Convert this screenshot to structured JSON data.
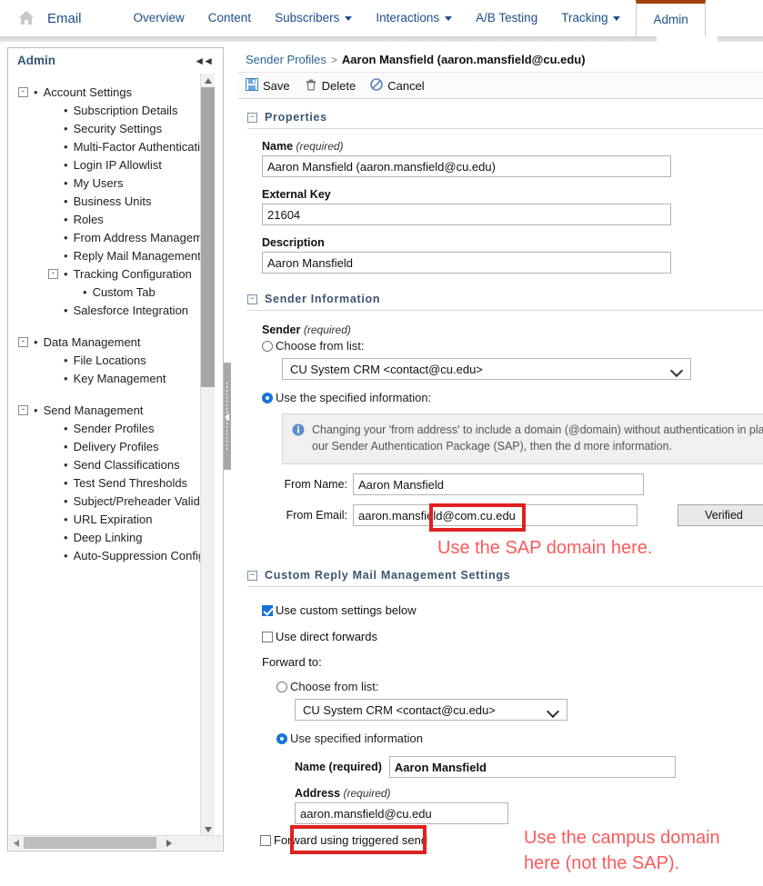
{
  "topnav": {
    "app_name": "Email",
    "home_icon": "home-icon",
    "items": [
      {
        "label": "Overview",
        "has_caret": false,
        "active": false
      },
      {
        "label": "Content",
        "has_caret": false,
        "active": false
      },
      {
        "label": "Subscribers",
        "has_caret": true,
        "active": false
      },
      {
        "label": "Interactions",
        "has_caret": true,
        "active": false
      },
      {
        "label": "A/B Testing",
        "has_caret": false,
        "active": false
      },
      {
        "label": "Tracking",
        "has_caret": true,
        "active": false
      },
      {
        "label": "Admin",
        "has_caret": false,
        "active": true
      }
    ],
    "active_tab_accent": "#a4400b"
  },
  "sidebar": {
    "title": "Admin",
    "collapse_icon": "collapse-left-icon",
    "tree": [
      {
        "label": "Account Settings",
        "level": 1,
        "expander": "-"
      },
      {
        "label": "Subscription Details",
        "level": 2
      },
      {
        "label": "Security Settings",
        "level": 2
      },
      {
        "label": "Multi-Factor Authentication",
        "level": 2
      },
      {
        "label": "Login IP Allowlist",
        "level": 2
      },
      {
        "label": "My Users",
        "level": 2
      },
      {
        "label": "Business Units",
        "level": 2
      },
      {
        "label": "Roles",
        "level": 2
      },
      {
        "label": "From Address Management",
        "level": 2
      },
      {
        "label": "Reply Mail Management",
        "level": 2
      },
      {
        "label": "Tracking Configuration",
        "level": 2,
        "expander": "-"
      },
      {
        "label": "Custom Tab",
        "level": 3
      },
      {
        "label": "Salesforce Integration",
        "level": 2
      },
      {
        "label": "Data Management",
        "level": 1,
        "expander": "-"
      },
      {
        "label": "File Locations",
        "level": 2
      },
      {
        "label": "Key Management",
        "level": 2
      },
      {
        "label": "Send Management",
        "level": 1,
        "expander": "-"
      },
      {
        "label": "Sender Profiles",
        "level": 2
      },
      {
        "label": "Delivery Profiles",
        "level": 2
      },
      {
        "label": "Send Classifications",
        "level": 2
      },
      {
        "label": "Test Send Thresholds",
        "level": 2
      },
      {
        "label": "Subject/Preheader Validation",
        "level": 2
      },
      {
        "label": "URL Expiration",
        "level": 2
      },
      {
        "label": "Deep Linking",
        "level": 2
      },
      {
        "label": "Auto-Suppression Configurat",
        "level": 2
      }
    ]
  },
  "breadcrumb": {
    "root": "Sender Profiles",
    "separator": ">",
    "current": "Aaron Mansfield (aaron.mansfield@cu.edu)"
  },
  "toolbar": {
    "save_label": "Save",
    "delete_label": "Delete",
    "cancel_label": "Cancel"
  },
  "properties": {
    "section_title": "Properties",
    "name_label": "Name",
    "name_required": "(required)",
    "name_value": "Aaron Mansfield (aaron.mansfield@cu.edu)",
    "external_key_label": "External Key",
    "external_key_value": "21604",
    "description_label": "Description",
    "description_value": "Aaron Mansfield"
  },
  "sender_information": {
    "section_title": "Sender Information",
    "sender_label": "Sender",
    "sender_required": "(required)",
    "choose_from_list_label": "Choose from list:",
    "choose_from_list_selected": false,
    "sender_select_value": "CU System CRM <contact@cu.edu>",
    "use_specified_label": "Use the specified information:",
    "use_specified_selected": true,
    "info_message": "Changing your 'from address' to include a domain (@domain) without authentication in place h brand protection. If you have purchased our Sender Authentication Package (SAP), then the d more information.",
    "from_name_label": "From Name:",
    "from_name_value": "Aaron Mansfield",
    "from_email_label": "From Email:",
    "from_email_value": "aaron.mansfield@com.cu.edu",
    "verified_button": "Verified"
  },
  "custom_reply": {
    "section_title": "Custom Reply Mail Management Settings",
    "use_custom_settings_label": "Use custom settings below",
    "use_custom_settings_checked": true,
    "use_direct_forwards_label": "Use direct forwards",
    "use_direct_forwards_checked": false,
    "forward_to_label": "Forward to:",
    "choose_from_list_label": "Choose from list:",
    "choose_from_list_selected": false,
    "forward_select_value": "CU System CRM <contact@cu.edu>",
    "use_specified_label": "Use specified information",
    "use_specified_selected": true,
    "name_label": "Name",
    "name_required": "(required)",
    "name_value": "Aaron Mansfield",
    "address_label": "Address",
    "address_required": "(required)",
    "address_value": "aaron.mansfield@cu.edu",
    "triggered_send_label": "Forward using triggered send",
    "triggered_send_checked": false
  },
  "annotations": {
    "color": "#fa5a5a",
    "box_color": "#e02020",
    "note_from_email": "Use the SAP domain here.",
    "note_address_line1": "Use the campus domain",
    "note_address_line2": "here (not the SAP)."
  }
}
